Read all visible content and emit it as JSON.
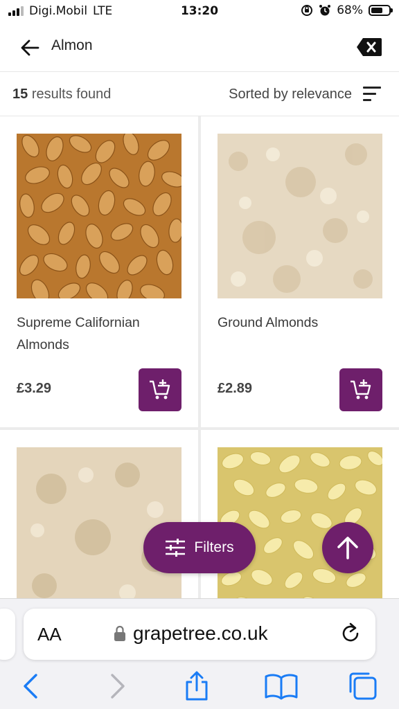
{
  "status_bar": {
    "carrier": "Digi.Mobil",
    "network": "LTE",
    "time": "13:20",
    "battery": "68%",
    "battery_level": 0.68
  },
  "search": {
    "query": "Almon"
  },
  "results": {
    "count": "15",
    "count_suffix": "results found",
    "sort_label": "Sorted by relevance"
  },
  "products": [
    {
      "name": "Supreme Californian Almonds",
      "price": "£3.29",
      "image": "whole-almonds-photo"
    },
    {
      "name": "Ground Almonds",
      "price": "£2.89",
      "image": "ground-almonds-photo"
    },
    {
      "name": "",
      "price": "",
      "image": "ground-almonds-photo"
    },
    {
      "name": "",
      "price": "",
      "image": "flaked-almonds-photo"
    }
  ],
  "floating": {
    "filters_label": "Filters"
  },
  "browser": {
    "aa_label": "AA",
    "url": "grapetree.co.uk"
  },
  "colors": {
    "brand_purple": "#6e1f6b",
    "ios_blue": "#1a7cf5"
  }
}
